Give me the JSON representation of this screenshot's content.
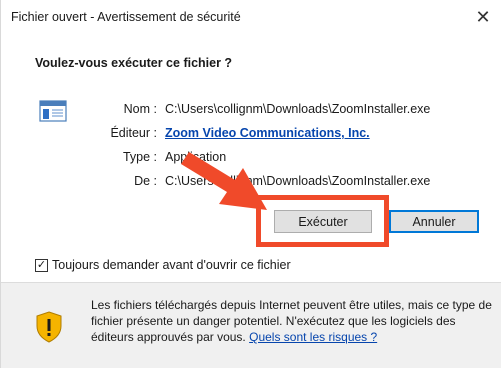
{
  "window": {
    "title": "Fichier ouvert - Avertissement de sécurité",
    "close_glyph": "✕"
  },
  "dialog": {
    "heading": "Voulez-vous exécuter ce fichier ?",
    "icon": "application-file-icon",
    "fields": {
      "name_label": "Nom :",
      "name_value": "C:\\Users\\collignm\\Downloads\\ZoomInstaller.exe",
      "publisher_label": "Éditeur :",
      "publisher_value": "Zoom Video Communications, Inc.",
      "type_label": "Type :",
      "type_value": "Application",
      "from_label": "De :",
      "from_value": "C:\\Users\\collignm\\Downloads\\ZoomInstaller.exe"
    },
    "buttons": {
      "run": "Exécuter",
      "cancel": "Annuler"
    },
    "checkbox": {
      "label": "Toujours demander avant d'ouvrir ce fichier",
      "checked": true,
      "check_glyph": "✓"
    }
  },
  "footer": {
    "icon": "shield-warning-icon",
    "message": "Les fichiers téléchargés depuis Internet peuvent être utiles, mais ce type de fichier présente un danger potentiel. N'exécutez que les logiciels des éditeurs approuvés par vous.",
    "link": "Quels sont les risques ?"
  },
  "annotations": {
    "highlight_color": "#f04a2a"
  }
}
